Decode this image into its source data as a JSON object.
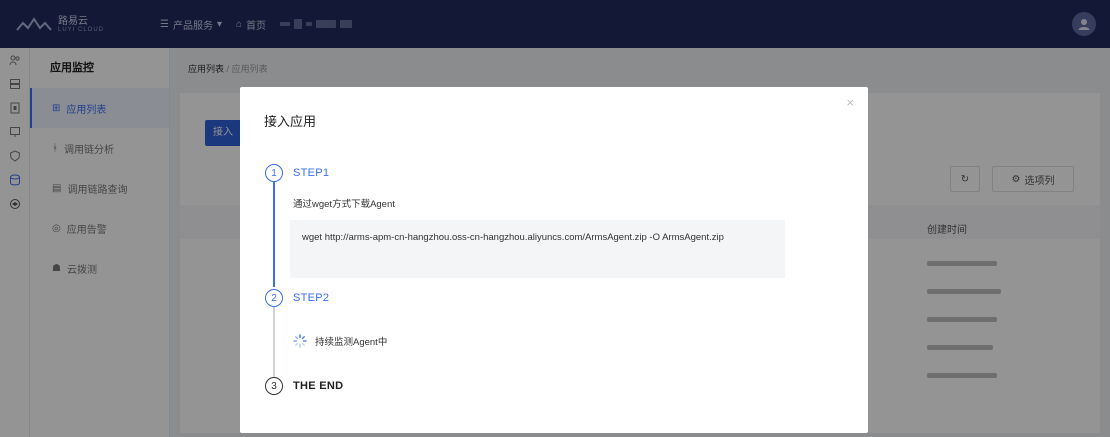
{
  "topbar": {
    "logo_text": "路易云",
    "logo_sub": "LUYI CLOUD",
    "nav_products": "产品服务",
    "nav_home": "首页",
    "accent": "#1f2a5c"
  },
  "sidebar": {
    "title": "应用监控",
    "items": [
      {
        "label": "应用列表",
        "icon": "grid-icon",
        "active": true
      },
      {
        "label": "调用链分析",
        "icon": "trace-icon",
        "active": false
      },
      {
        "label": "调用链路查询",
        "icon": "list-search-icon",
        "active": false
      },
      {
        "label": "应用告警",
        "icon": "alert-icon",
        "active": false
      },
      {
        "label": "云拨测",
        "icon": "cloud-probe-icon",
        "active": false
      }
    ]
  },
  "breadcrumb": {
    "root": "应用列表",
    "sep": "/",
    "current": "应用列表"
  },
  "content": {
    "primary_button": "接入",
    "columns_button": "选项列",
    "created_time_header": "创建时间"
  },
  "modal": {
    "title": "接入应用",
    "close": "×",
    "steps": [
      {
        "index": "1",
        "label": "STEP1"
      },
      {
        "index": "2",
        "label": "STEP2"
      },
      {
        "index": "3",
        "label": "THE END"
      }
    ],
    "step1_desc": "通过wget方式下载Agent",
    "command": "wget http://arms-apm-cn-hangzhou.oss-cn-hangzhou.aliyuncs.com/ArmsAgent.zip -O ArmsAgent.zip",
    "step2_status": "持续监测Agent中",
    "active_color": "#3b6ef5"
  }
}
